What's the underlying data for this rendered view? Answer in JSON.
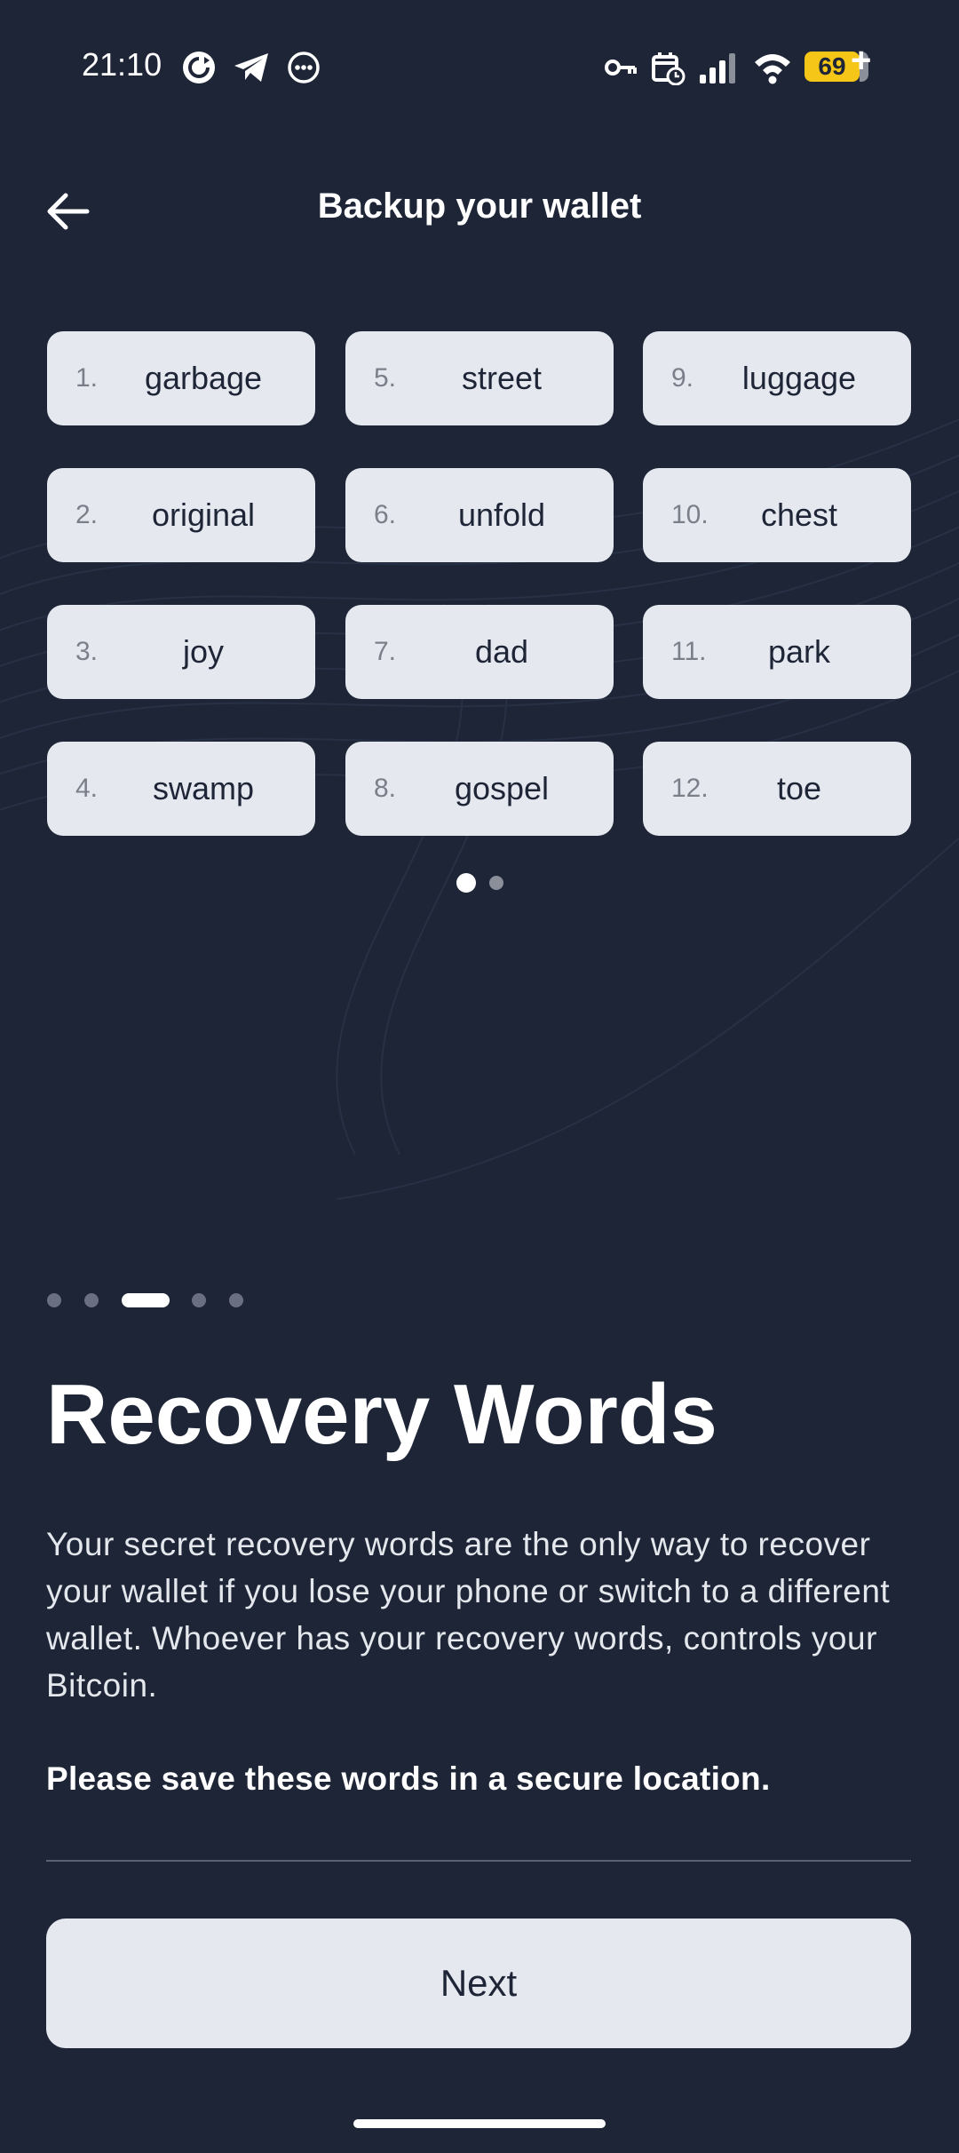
{
  "status_bar": {
    "time": "21:10",
    "battery_level": "69",
    "icons": [
      "sync-icon",
      "telegram-icon",
      "more-icon",
      "vpn-key-icon",
      "calendar-icon",
      "signal-icon",
      "wifi-icon",
      "battery-icon"
    ]
  },
  "header": {
    "title": "Backup your wallet",
    "back_icon": "arrow-left-icon"
  },
  "words": [
    {
      "num": "1.",
      "word": "garbage"
    },
    {
      "num": "2.",
      "word": "original"
    },
    {
      "num": "3.",
      "word": "joy"
    },
    {
      "num": "4.",
      "word": "swamp"
    },
    {
      "num": "5.",
      "word": "street"
    },
    {
      "num": "6.",
      "word": "unfold"
    },
    {
      "num": "7.",
      "word": "dad"
    },
    {
      "num": "8.",
      "word": "gospel"
    },
    {
      "num": "9.",
      "word": "luggage"
    },
    {
      "num": "10.",
      "word": "chest"
    },
    {
      "num": "11.",
      "word": "park"
    },
    {
      "num": "12.",
      "word": "toe"
    }
  ],
  "word_pager": {
    "total": 2,
    "active": 1
  },
  "steps": {
    "total": 5,
    "active": 3
  },
  "content": {
    "heading": "Recovery Words",
    "description": "Your secret recovery words are the only way to recover your wallet if you lose your phone or switch to a different wallet. Whoever has your recovery words, controls your Bitcoin.",
    "emphasis": "Please save these words in a secure location."
  },
  "actions": {
    "next_label": "Next"
  },
  "colors": {
    "background": "#1e2537",
    "chip": "#e5e9ef",
    "text_dark": "#1e2537",
    "battery": "#f5c518"
  }
}
